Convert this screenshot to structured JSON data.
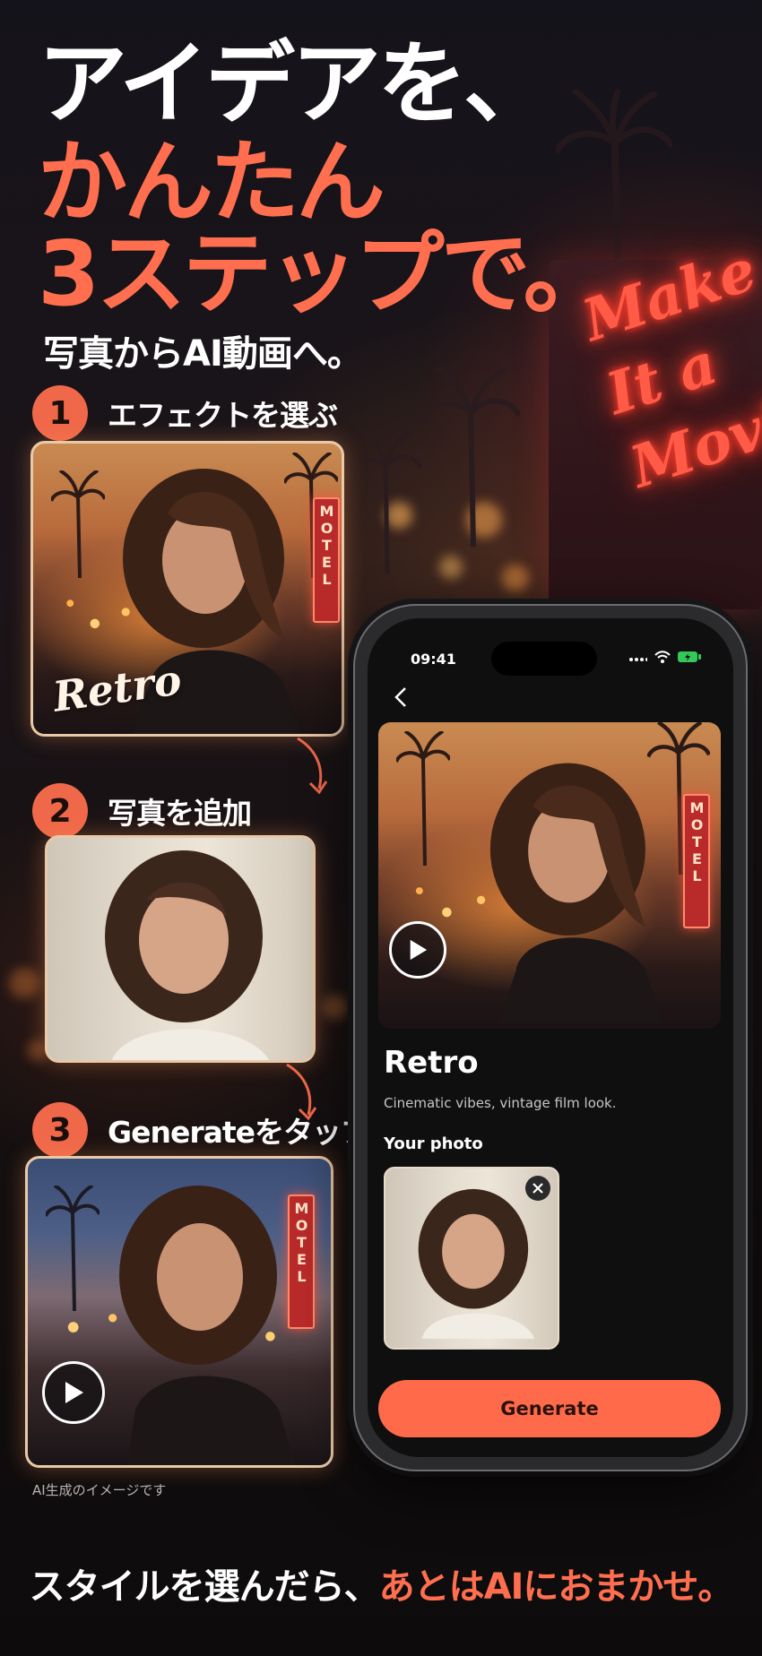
{
  "headline": {
    "line1": "アイデアを、",
    "line2": "かんたん",
    "line3": "3ステップで。"
  },
  "subtitle": "写真からAI動画へ。",
  "background_sign": {
    "line1": "Make",
    "line2": "It a",
    "line3": "Movie"
  },
  "steps": [
    {
      "number": "1",
      "label": "エフェクトを選ぶ",
      "card_script": "Retro",
      "sign_text": "MOTEL"
    },
    {
      "number": "2",
      "label": "写真を追加"
    },
    {
      "number": "3",
      "label": "Generateをタップ",
      "sign_text": "MOTEL"
    }
  ],
  "caption": "AI生成のイメージです",
  "tagline": {
    "part1": "スタイルを選んだら、",
    "part2": "あとはAIにおまかせ。"
  },
  "phone": {
    "status_time": "09:41",
    "effect_title": "Retro",
    "effect_description": "Cinematic vibes, vintage film look.",
    "photo_label": "Your photo",
    "generate_label": "Generate",
    "hero_sign_text": "MOTEL"
  },
  "colors": {
    "accent": "#ff6f4f",
    "button": "#ff6b4a",
    "background": "#15131a"
  }
}
